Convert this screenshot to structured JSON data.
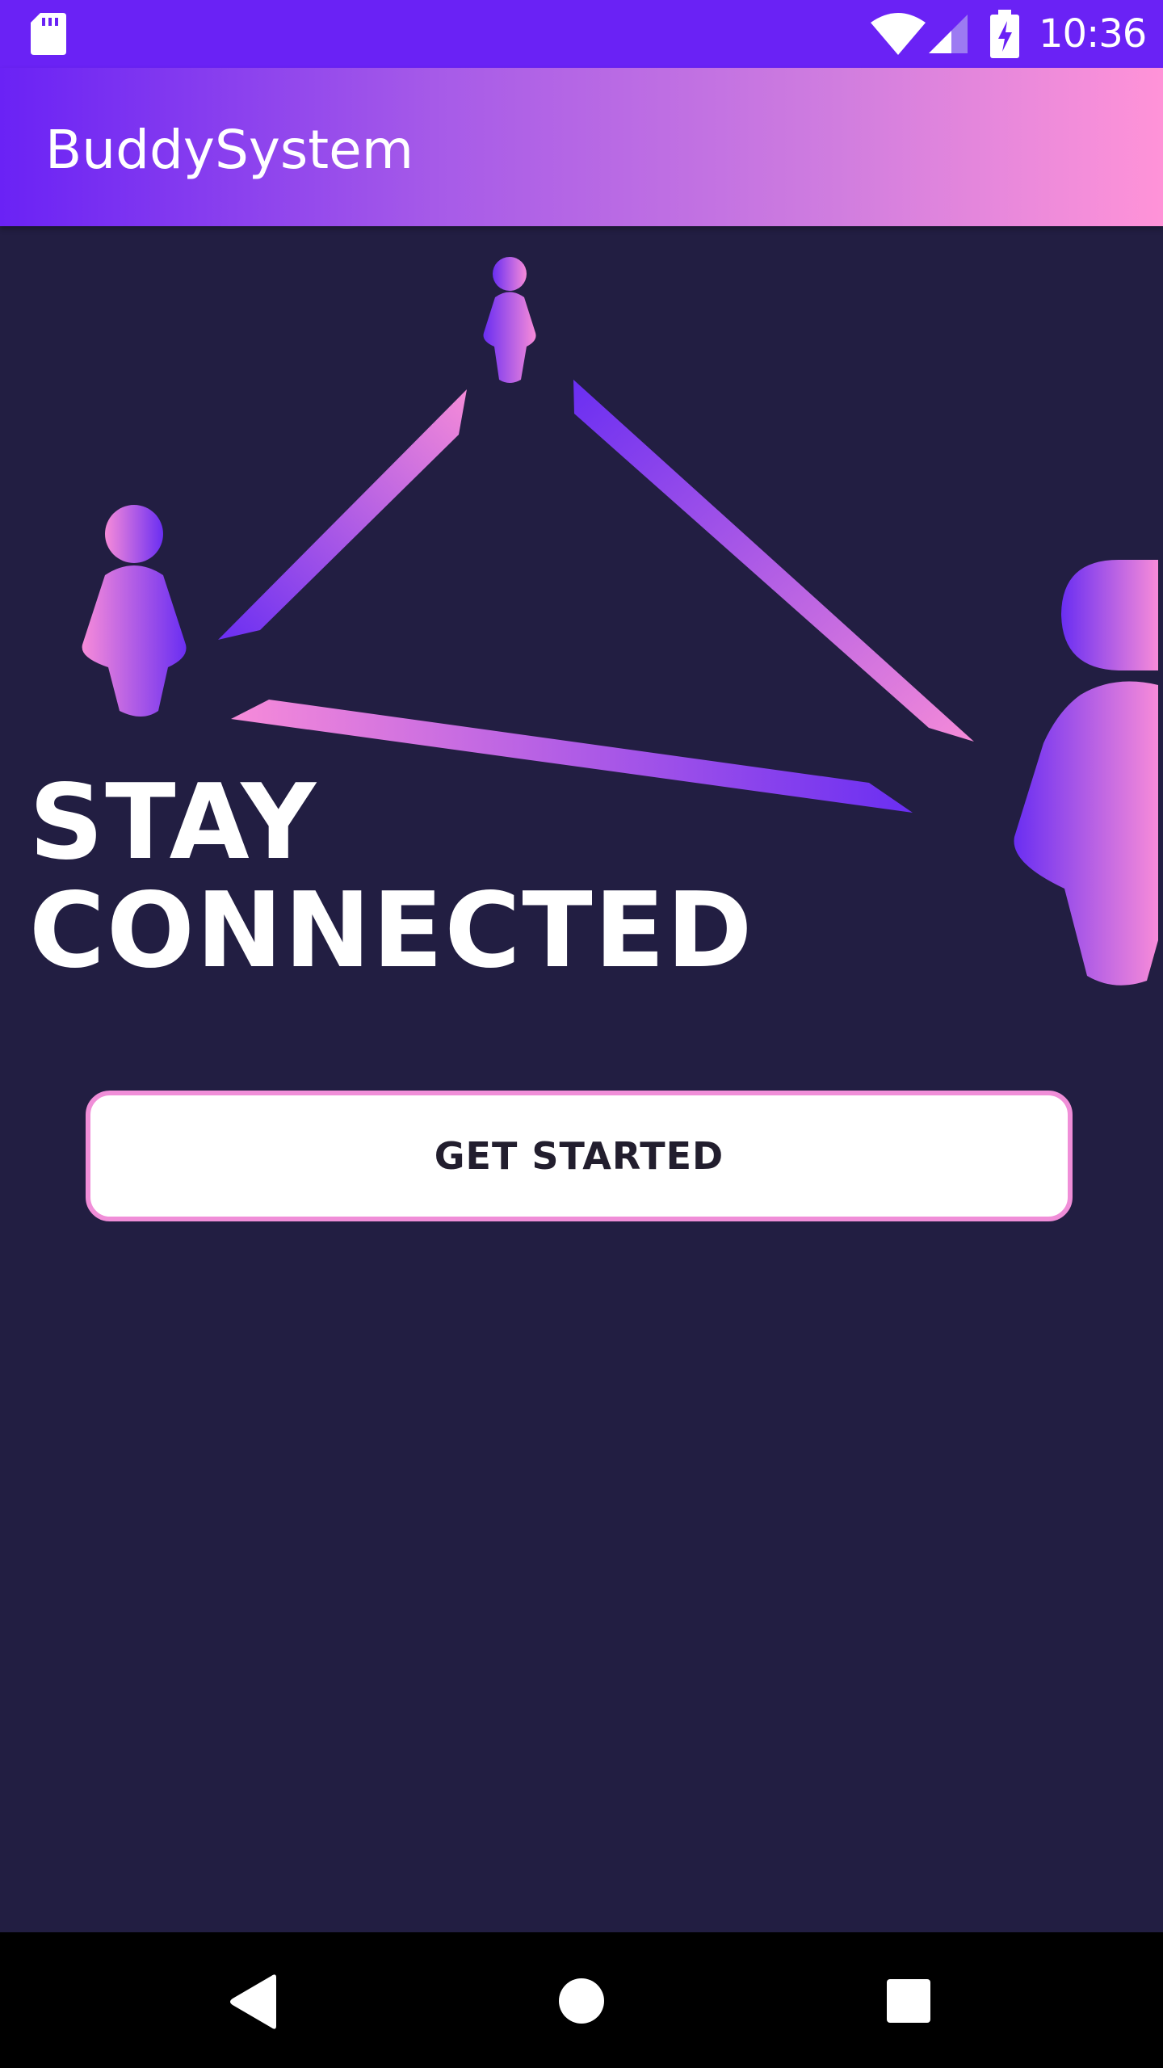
{
  "status_bar": {
    "time": "10:36",
    "icons": [
      "sd-card-icon",
      "wifi-icon",
      "cell-signal-icon",
      "battery-charging-icon"
    ]
  },
  "app_bar": {
    "title": "BuddySystem"
  },
  "hero": {
    "headline_line1": "STAY",
    "headline_line2": "CONNECTED"
  },
  "actions": {
    "get_started_label": "GET STARTED"
  },
  "nav_bar": {
    "icons": [
      "back-icon",
      "home-icon",
      "recents-icon"
    ]
  },
  "colors": {
    "background": "#221E42",
    "status_bar": "#6A22F5",
    "gradient_start": "#6A22F5",
    "gradient_end": "#FF93D8",
    "button_border": "#F08ED8",
    "button_bg": "#FFFFFF",
    "headline": "#FFFFFF"
  }
}
